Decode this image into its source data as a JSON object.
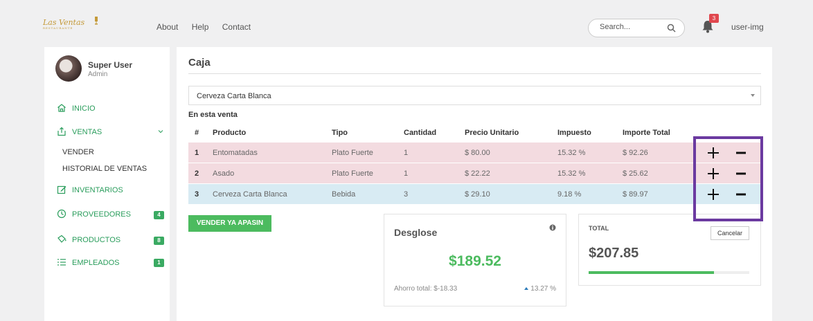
{
  "header": {
    "logo_text": "Las Ventas",
    "logo_sub": "RESTAURANTE",
    "nav": [
      "About",
      "Help",
      "Contact"
    ],
    "search_placeholder": "Search...",
    "notification_count": "3",
    "user_label": "user-img"
  },
  "sidebar": {
    "user_name": "Super User",
    "user_role": "Admin",
    "items": [
      {
        "label": "INICIO",
        "icon": "home-icon"
      },
      {
        "label": "VENTAS",
        "icon": "ventas-icon"
      },
      {
        "label": "INVENTARIOS",
        "icon": "edit-icon"
      },
      {
        "label": "PROVEEDORES",
        "icon": "clock-icon",
        "badge": "4"
      },
      {
        "label": "PRODUCTOS",
        "icon": "bucket-icon",
        "badge": "8"
      },
      {
        "label": "EMPLEADOS",
        "icon": "list-icon",
        "badge": "1"
      }
    ],
    "submenu": [
      "VENDER",
      "HISTORIAL DE VENTAS"
    ]
  },
  "main": {
    "title": "Caja",
    "selected_product": "Cerveza Carta Blanca",
    "section_label": "En esta venta",
    "columns": [
      "#",
      "Producto",
      "Tipo",
      "Cantidad",
      "Precio Unitario",
      "Impuesto",
      "Importe Total"
    ],
    "rows": [
      {
        "num": "1",
        "producto": "Entomatadas",
        "tipo": "Plato Fuerte",
        "cantidad": "1",
        "precio": "$ 80.00",
        "impuesto": "15.32 %",
        "importe": "$ 92.26"
      },
      {
        "num": "2",
        "producto": "Asado",
        "tipo": "Plato Fuerte",
        "cantidad": "1",
        "precio": "$ 22.22",
        "impuesto": "15.32 %",
        "importe": "$ 25.62"
      },
      {
        "num": "3",
        "producto": "Cerveza Carta Blanca",
        "tipo": "Bebida",
        "cantidad": "3",
        "precio": "$ 29.10",
        "impuesto": "9.18 %",
        "importe": "$ 89.97"
      }
    ],
    "sell_button": "VENDER YA APASIN",
    "desglose": {
      "title": "Desglose",
      "amount": "$189.52",
      "saving": "Ahorro total: $-18.33",
      "pct": "13.27 %"
    },
    "total": {
      "label": "TOTAL",
      "amount": "$207.85",
      "cancel": "Cancelar",
      "progress": 0.78
    }
  },
  "colors": {
    "accent": "#4cbb5f",
    "row_pink": "#f3dbe0",
    "row_blue": "#d8ebf3",
    "highlight_box": "#6b3aa0",
    "badge": "#3aaa62"
  }
}
